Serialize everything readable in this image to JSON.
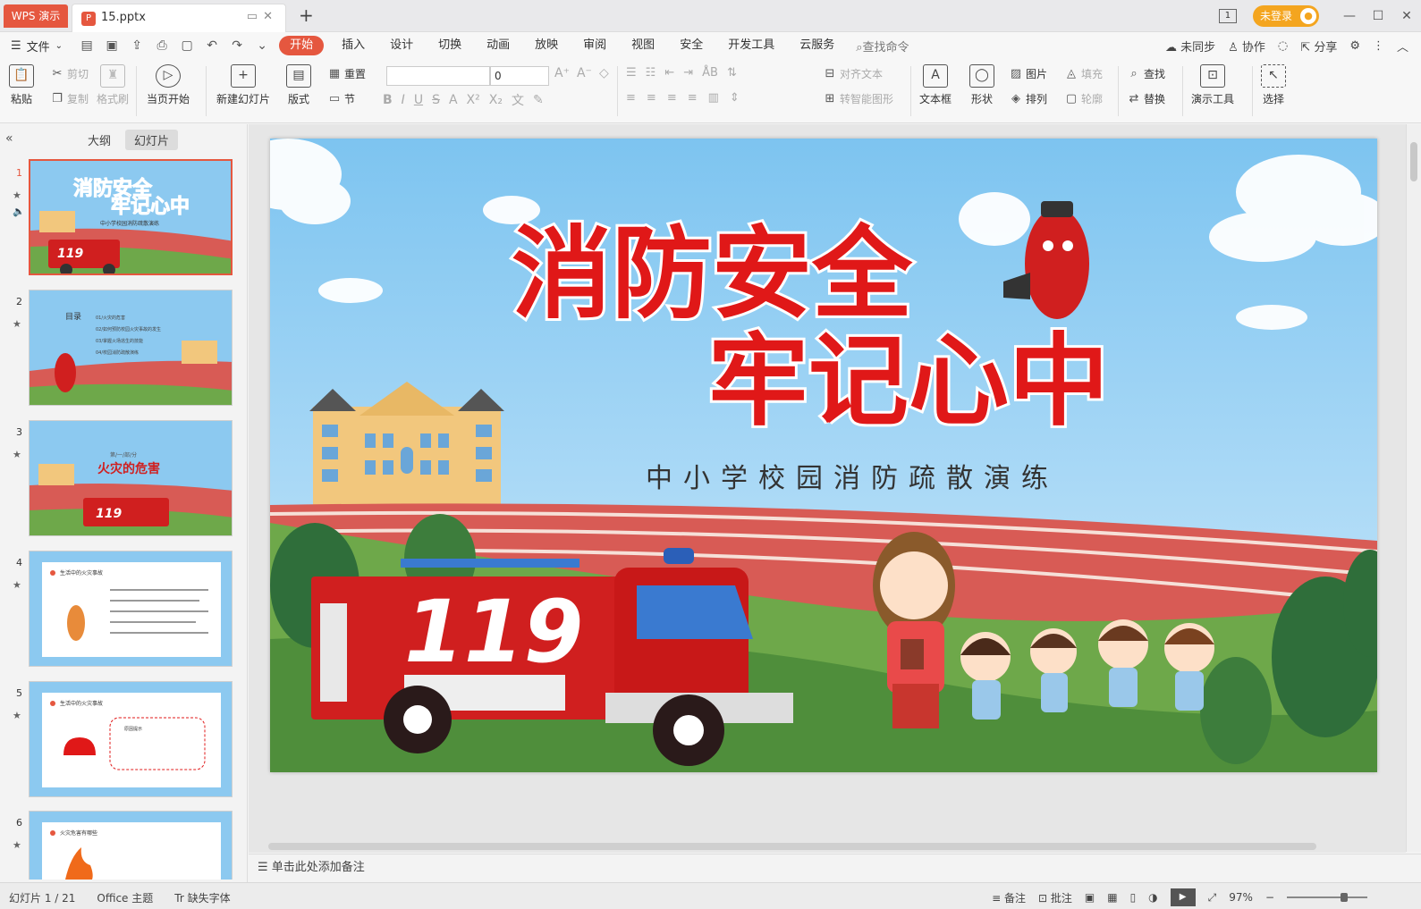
{
  "titlebar": {
    "app_tab": "WPS 演示",
    "file_tab": "15.pptx",
    "add_tab": "+",
    "login": "未登录",
    "window_icon": "1"
  },
  "menu": {
    "file": "文件",
    "tabs": [
      "开始",
      "插入",
      "设计",
      "切换",
      "动画",
      "放映",
      "审阅",
      "视图",
      "安全",
      "开发工具",
      "云服务"
    ],
    "search": "查找命令",
    "sync": "未同步",
    "collab": "协作",
    "share": "分享"
  },
  "ribbon": {
    "paste": "粘贴",
    "cut": "剪切",
    "copy": "复制",
    "format_painter": "格式刷",
    "from_start": "当页开始",
    "new_slide": "新建幻灯片",
    "layout": "版式",
    "reset": "重置",
    "section": "节",
    "font_size": "0",
    "align_text": "对齐文本",
    "smartart": "转智能图形",
    "textbox": "文本框",
    "shape": "形状",
    "picture": "图片",
    "arrange": "排列",
    "fill": "填充",
    "outline": "轮廓",
    "find": "查找",
    "replace": "替换",
    "present_tools": "演示工具",
    "select": "选择"
  },
  "panel": {
    "tab_outline": "大纲",
    "tab_slides": "幻灯片",
    "slide_numbers": [
      "1",
      "2",
      "3",
      "4",
      "5",
      "6"
    ],
    "thumb1_title1": "消防安全",
    "thumb1_title2": "牢记心中",
    "thumb1_sub": "中小学校园消防疏散演练",
    "thumb1_truck": "119",
    "thumb2_heading": "目录",
    "thumb2_items": [
      "01/火灾的危害",
      "02/如何预防校园火灾事故的发生",
      "03/掌握火场逃生的技能",
      "04/校园消防疏散演练"
    ],
    "thumb3_part": "第/一/部/分",
    "thumb3_title": "火灾的危害",
    "thumb3_truck": "119",
    "thumb4_title": "生活中的火灾事故",
    "thumb5_title": "生活中的火灾事故",
    "thumb5_box": "原因提示",
    "thumb6_title": "火灾危害有哪些"
  },
  "slide": {
    "title_line1": "消防安全",
    "title_line2": "牢记心中",
    "subtitle": "中小学校园消防疏散演练",
    "truck_number": "119"
  },
  "notes": {
    "placeholder": "单击此处添加备注"
  },
  "status": {
    "slide_count": "幻灯片 1 / 21",
    "theme": "Office 主题",
    "missing_font": "缺失字体",
    "notes_btn": "备注",
    "comment_btn": "批注",
    "zoom": "97%"
  },
  "colors": {
    "accent": "#e5573f",
    "sky": "#8cc9f0",
    "track": "#d85b55",
    "grass": "#6ea84a",
    "truck": "#d01f1f"
  }
}
